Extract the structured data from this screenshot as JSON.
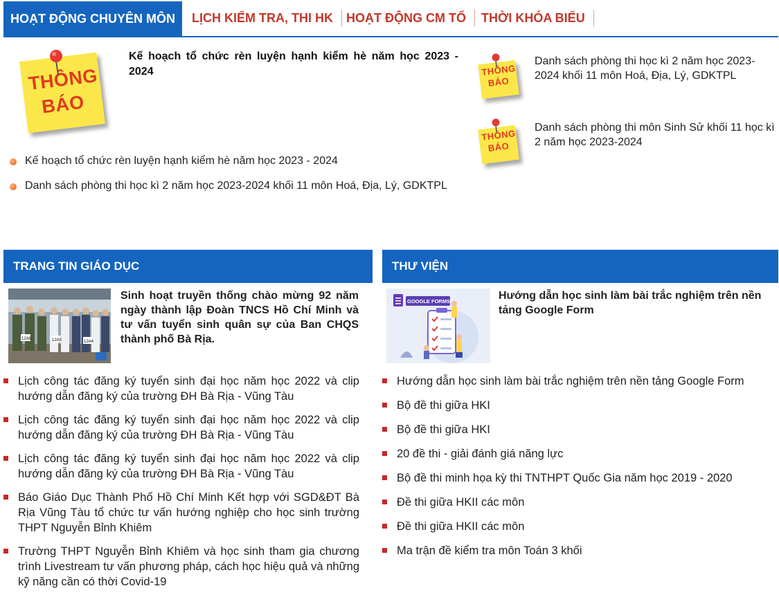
{
  "tabs": {
    "active": "HOẠT ĐỘNG CHUYÊN MÔN",
    "items": [
      "LỊCH KIỂM TRA, THI HK",
      "HOẠT ĐỘNG CM TỔ",
      "THỜI KHÓA BIỂU"
    ]
  },
  "notice_image": {
    "line1": "THÔNG",
    "line2": "BÁO"
  },
  "featured_notice": "Kế hoạch tổ chức rèn luyện hạnh kiểm hè năm học 2023 - 2024",
  "notice_list": [
    "Kế hoạch tổ chức rèn luyện hạnh kiểm hè năm học 2023 - 2024",
    "Danh sách phòng thi học kì 2 năm học 2023-2024 khối 11 môn Hoá, Địa, Lý, GDKTPL"
  ],
  "side_notices": [
    "Danh sách phòng thi học kì 2 năm học 2023-2024 khối 11 môn Hoá, Địa, Lý, GDKTPL",
    "Danh sách phòng thi môn Sinh Sử khối 11 học kì 2 năm học 2023-2024"
  ],
  "news": {
    "header": "TRANG TIN GIÁO DỤC",
    "featured": "Sinh hoạt truyền thống chào mừng 92 năm ngày thành lập Đoàn TNCS Hồ Chí Minh và tư vấn tuyển sinh quân sự của Ban CHQS thành phố Bà Rịa.",
    "photo_signs": [
      "12A6",
      "12A5",
      "12A4"
    ],
    "items": [
      "Lịch công tác đăng ký tuyển sinh đại học năm học 2022 và clip hướng dẫn đăng ký của trường ĐH Bà Rịa - Vũng Tàu",
      "Lịch công tác đăng ký tuyển sinh đại học năm học 2022 và clip hướng dẫn đăng ký của trường ĐH Bà Rịa - Vũng Tàu",
      "Lịch công tác đăng ký tuyển sinh đại học năm học 2022 và clip hướng dẫn đăng ký của trường ĐH Bà Rịa - Vũng Tàu",
      "Báo Giáo Dục Thành Phố Hồ Chí Minh Kết hợp với SGD&ĐT Bà Rịa Vũng Tàu tổ chức tư vấn hướng nghiệp cho học sinh trường THPT Nguyễn Bỉnh Khiêm",
      "Trường THPT Nguyễn Bỉnh Khiêm và học sinh tham gia chương trình Livestream tư vấn phương pháp, cách học hiệu quả và những kỹ năng cần có thời Covid-19"
    ]
  },
  "library": {
    "header": "THƯ VIỆN",
    "featured": "Hướng dẫn học sinh làm bài trắc nghiệm trên nền tảng Google Form",
    "thumb_label": "GOOGLE FORMS",
    "items": [
      "Hướng dẫn học sinh làm bài trắc nghiệm trên nền tảng Google Form",
      "Bộ đề thi giữa HKI",
      "Bộ đề thi giữa HKI",
      "20 đề thi - giải đánh giá năng lực",
      "Bộ đề thi minh họa kỳ thi TNTHPT Quốc Gia năm học 2019 - 2020",
      "Đề thi giữa HKII các môn",
      "Đề thi giữa HKII các môn",
      "Ma trận đề kiểm tra môn Toán 3 khối"
    ]
  },
  "colors": {
    "primary": "#1565c0",
    "tab_text": "#c0392b",
    "bullet_red": "#c62828",
    "bullet_orange": "#e05a14",
    "sticky": "#fbe74a"
  }
}
